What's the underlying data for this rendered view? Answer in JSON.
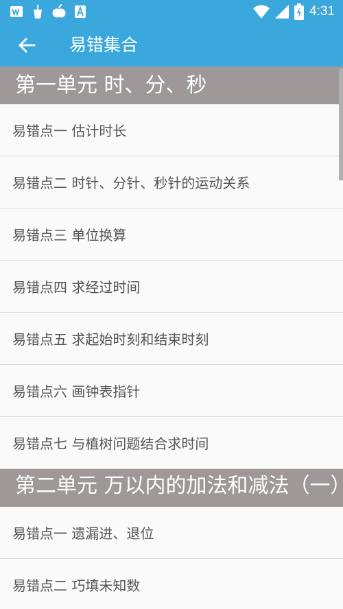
{
  "status_bar": {
    "time": "4:31",
    "icons": [
      "app-w-icon",
      "drink-icon",
      "apple-icon",
      "a-badge-icon",
      "wifi-icon",
      "signal-icon",
      "battery-charging-icon"
    ]
  },
  "app_bar": {
    "title": "易错集合",
    "back_icon": "arrow-left-icon"
  },
  "sections": [
    {
      "header": "第一单元 时、分、秒",
      "items": [
        "易错点一 估计时长",
        "易错点二 时针、分针、秒针的运动关系",
        "易错点三 单位换算",
        "易错点四 求经过时间",
        "易错点五 求起始时刻和结束时刻",
        "易错点六 画钟表指针",
        "易错点七 与植树问题结合求时间"
      ]
    },
    {
      "header": "第二单元 万以内的加法和减法（一）",
      "items": [
        "易错点一 遗漏进、退位",
        "易错点二 巧填未知数"
      ]
    }
  ],
  "colors": {
    "primary": "#3aa8dc",
    "section_bg": "#9e9898",
    "item_text": "#555555",
    "divider": "#dedede"
  }
}
